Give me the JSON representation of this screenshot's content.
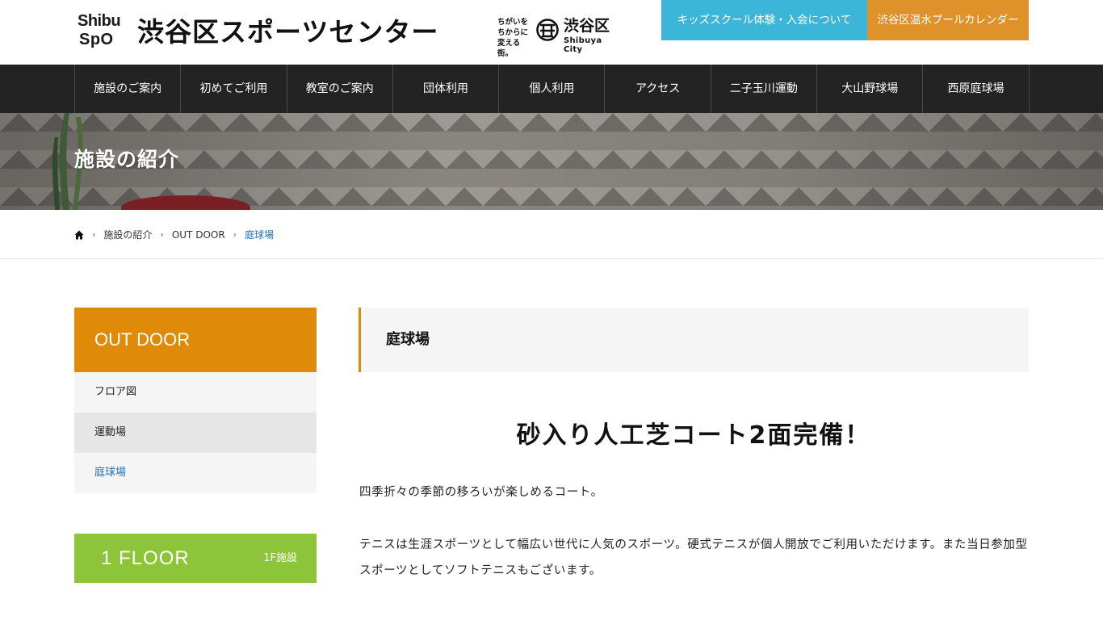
{
  "header": {
    "logo_line1": "Shibu",
    "logo_line2": "SpO",
    "site_title": "渋谷区スポーツセンター",
    "city_tagline_1": "ちがいを",
    "city_tagline_2": "ちからに",
    "city_tagline_3": "変える街。",
    "city_name": "渋谷区",
    "city_name_en": "Shibuya City",
    "kids_button": "キッズスクール体験・入会について",
    "pool_button": "渋谷区温水プールカレンダー",
    "colors": {
      "kids": "#3cb6d8",
      "pool": "#e0922a"
    }
  },
  "nav": {
    "items": [
      "施設のご案内",
      "初めてご利用",
      "教室のご案内",
      "団体利用",
      "個人利用",
      "アクセス",
      "二子玉川運動",
      "大山野球場",
      "西原庭球場"
    ]
  },
  "hero": {
    "title": "施設の紹介"
  },
  "breadcrumb": {
    "home_icon": "home-icon",
    "items": [
      "施設の紹介",
      "OUT DOOR",
      "庭球場"
    ]
  },
  "sidebar": {
    "heading": "OUT DOOR",
    "items": [
      "フロア図",
      "運動場",
      "庭球場"
    ],
    "floor_box": {
      "title": "1 FLOOR",
      "subtitle": "1F施設"
    },
    "colors": {
      "heading": "#e08a0a",
      "floor": "#8cc43a",
      "active_link": "#2a6fb2"
    }
  },
  "main": {
    "heading": "庭球場",
    "headline": "砂入り人工芝コート2面完備！",
    "paragraph1": "四季折々の季節の移ろいが楽しめるコート。",
    "paragraph2": "テニスは生涯スポーツとして幅広い世代に人気のスポーツ。硬式テニスが個人開放でご利用いただけます。また当日参加型スポーツとしてソフトテニスもございます。"
  }
}
